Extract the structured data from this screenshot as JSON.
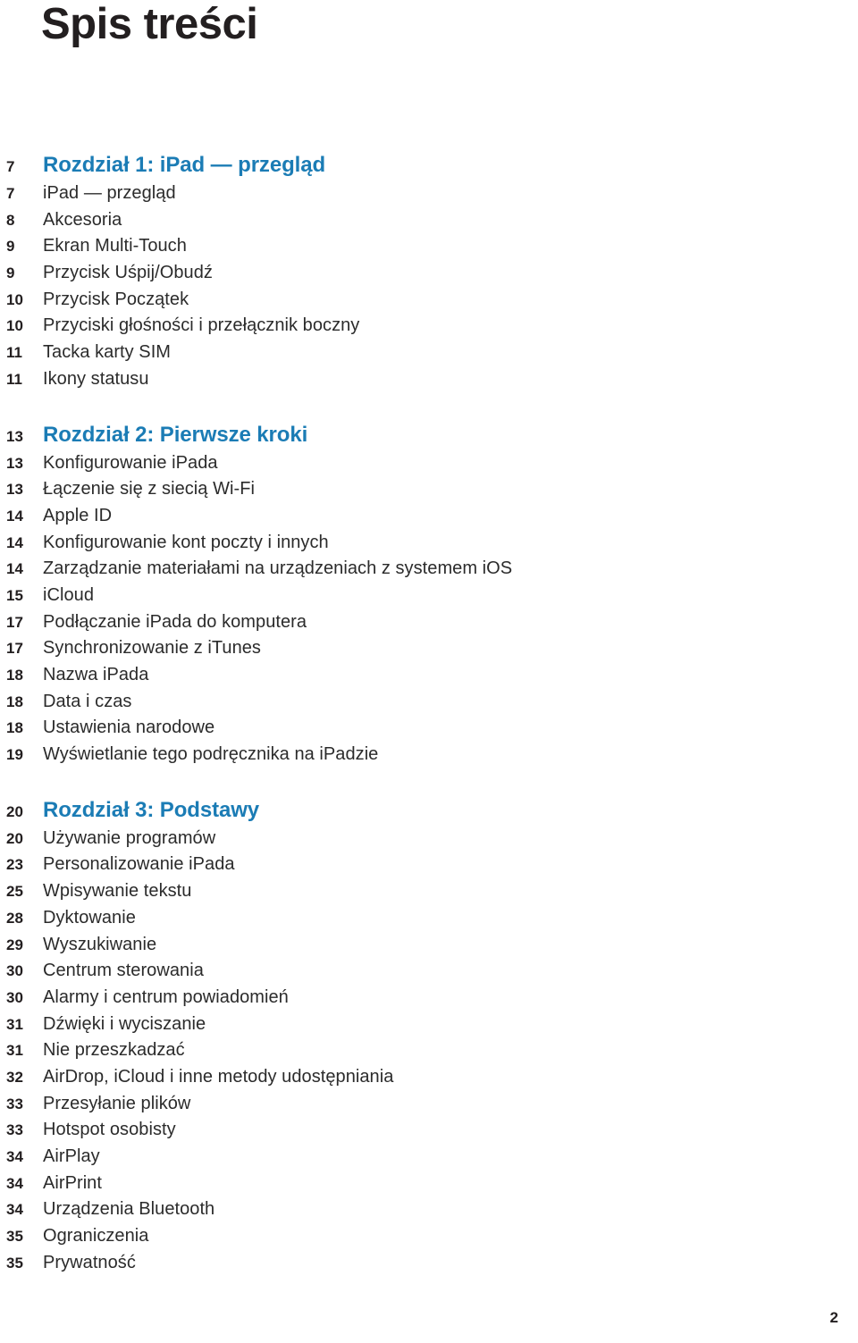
{
  "document": {
    "title": "Spis treści",
    "folio": "2",
    "accent_color": "#1b7cb5",
    "text_color": "#2b2b2b"
  },
  "toc": {
    "sections": [
      {
        "chapter": {
          "page": "7",
          "label": "Rozdział 1: iPad — przegląd"
        },
        "entries": [
          {
            "page": "7",
            "label": "iPad — przegląd"
          },
          {
            "page": "8",
            "label": "Akcesoria"
          },
          {
            "page": "9",
            "label": "Ekran Multi-Touch"
          },
          {
            "page": "9",
            "label": "Przycisk Uśpij/Obudź"
          },
          {
            "page": "10",
            "label": "Przycisk Początek"
          },
          {
            "page": "10",
            "label": "Przyciski głośności i przełącznik boczny"
          },
          {
            "page": "11",
            "label": "Tacka karty SIM"
          },
          {
            "page": "11",
            "label": "Ikony statusu"
          }
        ]
      },
      {
        "chapter": {
          "page": "13",
          "label": "Rozdział 2: Pierwsze kroki"
        },
        "entries": [
          {
            "page": "13",
            "label": "Konfigurowanie iPada"
          },
          {
            "page": "13",
            "label": "Łączenie się z siecią Wi-Fi"
          },
          {
            "page": "14",
            "label": "Apple ID"
          },
          {
            "page": "14",
            "label": "Konfigurowanie kont poczty i innych"
          },
          {
            "page": "14",
            "label": "Zarządzanie materiałami na urządzeniach z systemem iOS"
          },
          {
            "page": "15",
            "label": "iCloud"
          },
          {
            "page": "17",
            "label": "Podłączanie iPada do komputera"
          },
          {
            "page": "17",
            "label": "Synchronizowanie z iTunes"
          },
          {
            "page": "18",
            "label": "Nazwa iPada"
          },
          {
            "page": "18",
            "label": "Data i czas"
          },
          {
            "page": "18",
            "label": "Ustawienia narodowe"
          },
          {
            "page": "19",
            "label": "Wyświetlanie tego podręcznika na iPadzie"
          }
        ]
      },
      {
        "chapter": {
          "page": "20",
          "label": "Rozdział 3: Podstawy"
        },
        "entries": [
          {
            "page": "20",
            "label": "Używanie programów"
          },
          {
            "page": "23",
            "label": "Personalizowanie iPada"
          },
          {
            "page": "25",
            "label": "Wpisywanie tekstu"
          },
          {
            "page": "28",
            "label": "Dyktowanie"
          },
          {
            "page": "29",
            "label": "Wyszukiwanie"
          },
          {
            "page": "30",
            "label": "Centrum sterowania"
          },
          {
            "page": "30",
            "label": "Alarmy i centrum powiadomień"
          },
          {
            "page": "31",
            "label": "Dźwięki i wyciszanie"
          },
          {
            "page": "31",
            "label": "Nie przeszkadzać"
          },
          {
            "page": "32",
            "label": "AirDrop, iCloud i inne metody udostępniania"
          },
          {
            "page": "33",
            "label": "Przesyłanie plików"
          },
          {
            "page": "33",
            "label": "Hotspot osobisty"
          },
          {
            "page": "34",
            "label": "AirPlay"
          },
          {
            "page": "34",
            "label": "AirPrint"
          },
          {
            "page": "34",
            "label": "Urządzenia Bluetooth"
          },
          {
            "page": "35",
            "label": "Ograniczenia"
          },
          {
            "page": "35",
            "label": "Prywatność"
          }
        ]
      }
    ]
  }
}
